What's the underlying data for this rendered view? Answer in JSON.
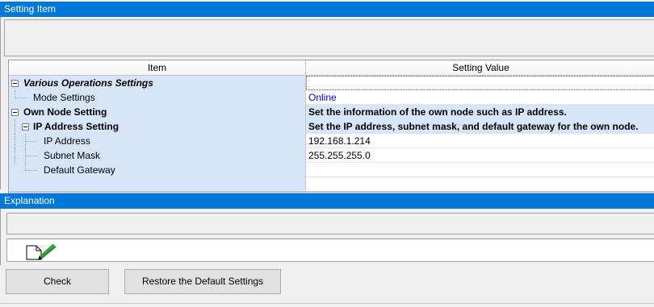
{
  "setting_section": {
    "title": "Setting Item"
  },
  "grid": {
    "columns": {
      "item": "Item",
      "value": "Setting Value"
    },
    "rows": {
      "various_ops": {
        "label": "Various Operations Settings",
        "value": ""
      },
      "mode_settings": {
        "label": "Mode Settings",
        "value": "Online"
      },
      "own_node": {
        "label": "Own Node Setting",
        "value": "Set the information of the own node such as IP address."
      },
      "ip_address_setting": {
        "label": "IP Address Setting",
        "value": "Set the IP address, subnet mask, and default gateway for the own node."
      },
      "ip_address": {
        "label": "IP Address",
        "value": "192.168.1.214"
      },
      "subnet_mask": {
        "label": "Subnet Mask",
        "value": "255.255.255.0"
      },
      "default_gateway": {
        "label": "Default Gateway",
        "value": ""
      }
    }
  },
  "explanation_section": {
    "title": "Explanation"
  },
  "buttons": {
    "check": "Check",
    "restore": "Restore the Default Settings"
  },
  "icons": {
    "expander": "collapse-icon",
    "explanation": "document-pencil-icon"
  },
  "colors": {
    "header_bar": "#0078d7",
    "group_row": "#d6e6f8",
    "link_value": "#0000cc"
  }
}
